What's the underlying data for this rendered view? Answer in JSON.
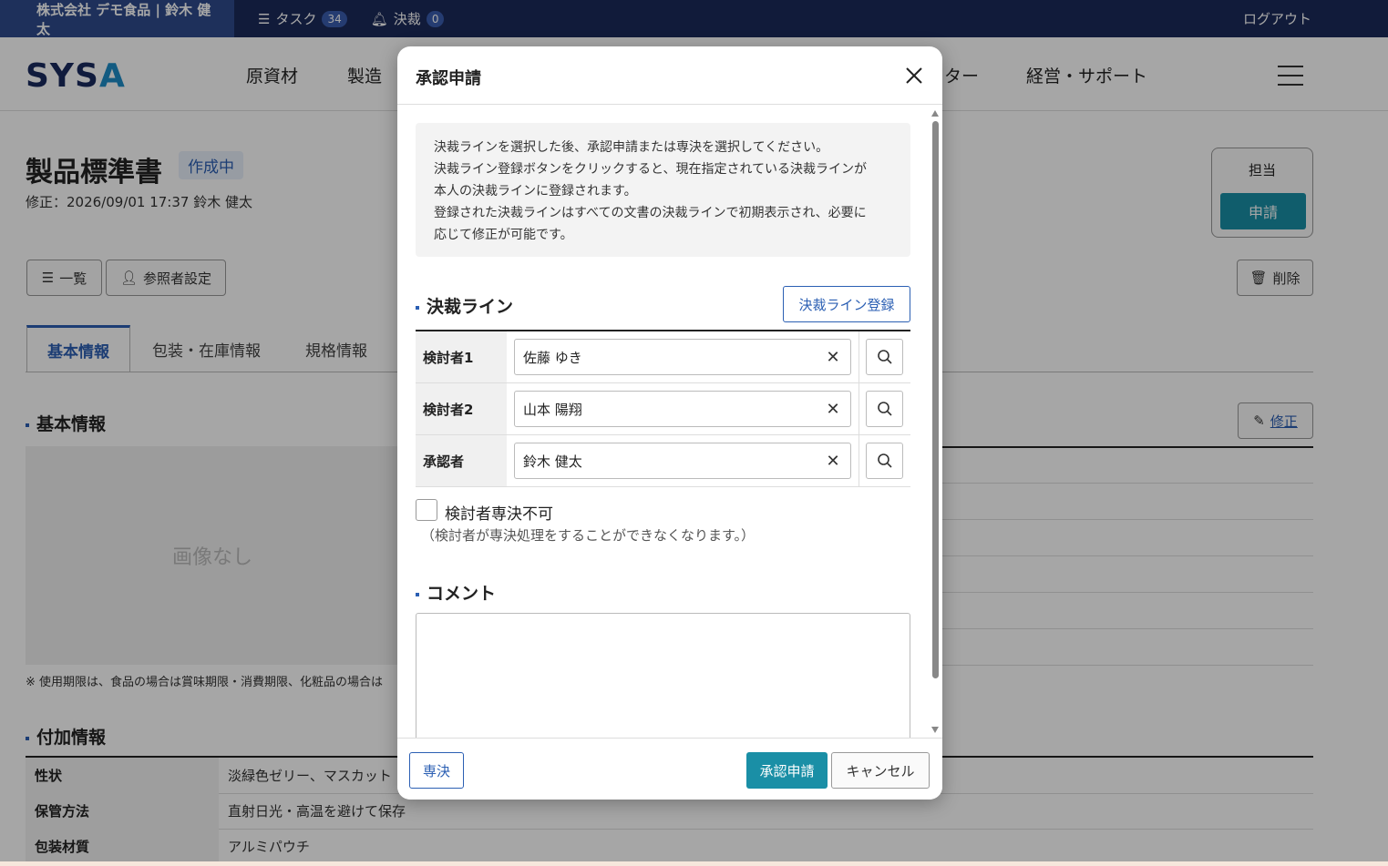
{
  "topbar": {
    "company": "株式会社 デモ食品 | 鈴木 健太",
    "task_label": "タスク",
    "task_count": "34",
    "approval_label": "決裁",
    "approval_count": "0",
    "logout": "ログアウト"
  },
  "header": {
    "logo_main": "SYS",
    "logo_accent": "A",
    "nav": [
      "原資材",
      "製造",
      "ター",
      "経営・サポート"
    ]
  },
  "page": {
    "title": "製品標準書",
    "status": "作成中",
    "modified": "修正：2026/09/01 17:37 鈴木 健太",
    "list_button": "一覧",
    "viewer_button": "参照者設定",
    "delete_button": "削除",
    "side_label": "担当",
    "side_apply": "申請",
    "tabs": [
      "基本情報",
      "包装・在庫情報",
      "規格情報"
    ],
    "basic_section": "基本情報",
    "edit_button": "修正",
    "no_image": "画像なし",
    "note": "※ 使用期限は、食品の場合は賞味期限・消費期限、化粧品の場合は",
    "extra_section": "付加情報",
    "extra_rows": [
      {
        "key": "性状",
        "value": "淡緑色ゼリー、マスカット"
      },
      {
        "key": "保管方法",
        "value": "直射日光・高温を避けて保存"
      },
      {
        "key": "包装材質",
        "value": "アルミパウチ"
      }
    ]
  },
  "modal": {
    "title": "承認申請",
    "info_lines": [
      "決裁ラインを選択した後、承認申請または専決を選択してください。",
      "決裁ライン登録ボタンをクリックすると、現在指定されている決裁ラインが",
      "本人の決裁ラインに登録されます。",
      "登録された決裁ラインはすべての文書の決裁ラインで初期表示され、必要に",
      "応じて修正が可能です。"
    ],
    "line_section": "決裁ライン",
    "register_button": "決裁ライン登録",
    "rows": [
      {
        "label": "検討者1",
        "value": "佐藤 ゆき"
      },
      {
        "label": "検討者2",
        "value": "山本 陽翔"
      },
      {
        "label": "承認者",
        "value": "鈴木 健太"
      }
    ],
    "checkbox_label": "検討者専決不可",
    "checkbox_note": "（検討者が専決処理をすることができなくなります。）",
    "comment_section": "コメント",
    "comment_value": "",
    "sen_button": "専決",
    "submit_button": "承認申請",
    "cancel_button": "キャンセル"
  }
}
